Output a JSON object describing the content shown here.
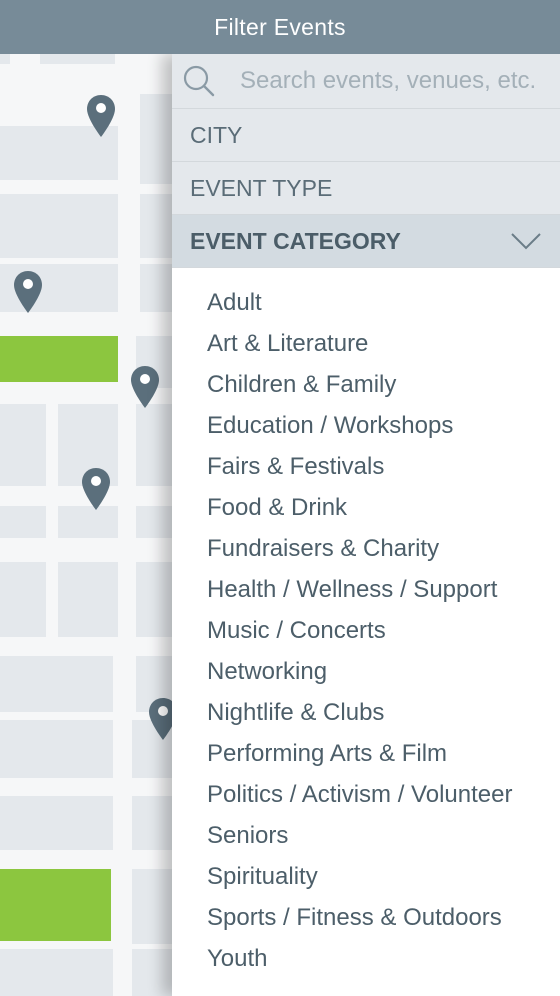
{
  "header": {
    "title": "Filter Events"
  },
  "search": {
    "placeholder": "Search events, venues, etc.",
    "value": ""
  },
  "filters": {
    "city": {
      "label": "CITY",
      "expanded": false
    },
    "event_type": {
      "label": "EVENT TYPE",
      "expanded": false
    },
    "event_category": {
      "label": "EVENT CATEGORY",
      "expanded": true
    }
  },
  "categories": [
    "Adult",
    "Art & Literature",
    "Children & Family",
    "Education / Workshops",
    "Fairs & Festivals",
    "Food & Drink",
    "Fundraisers & Charity",
    "Health / Wellness / Support",
    "Music / Concerts",
    "Networking",
    "Nightlife & Clubs",
    "Performing Arts & Film",
    "Politics / Activism / Volunteer",
    "Seniors",
    "Spirituality",
    "Sports / Fitness & Outdoors",
    "Youth"
  ],
  "icons": {
    "search": "search-icon",
    "chevron": "chevron-down-icon",
    "map_pin": "map-pin-icon"
  },
  "colors": {
    "header": "#778b98",
    "pin": "#5b6f7c",
    "park": "#8cc63f",
    "filter_row": "#e4e8ec",
    "filter_row_active": "#d3dbe1"
  }
}
